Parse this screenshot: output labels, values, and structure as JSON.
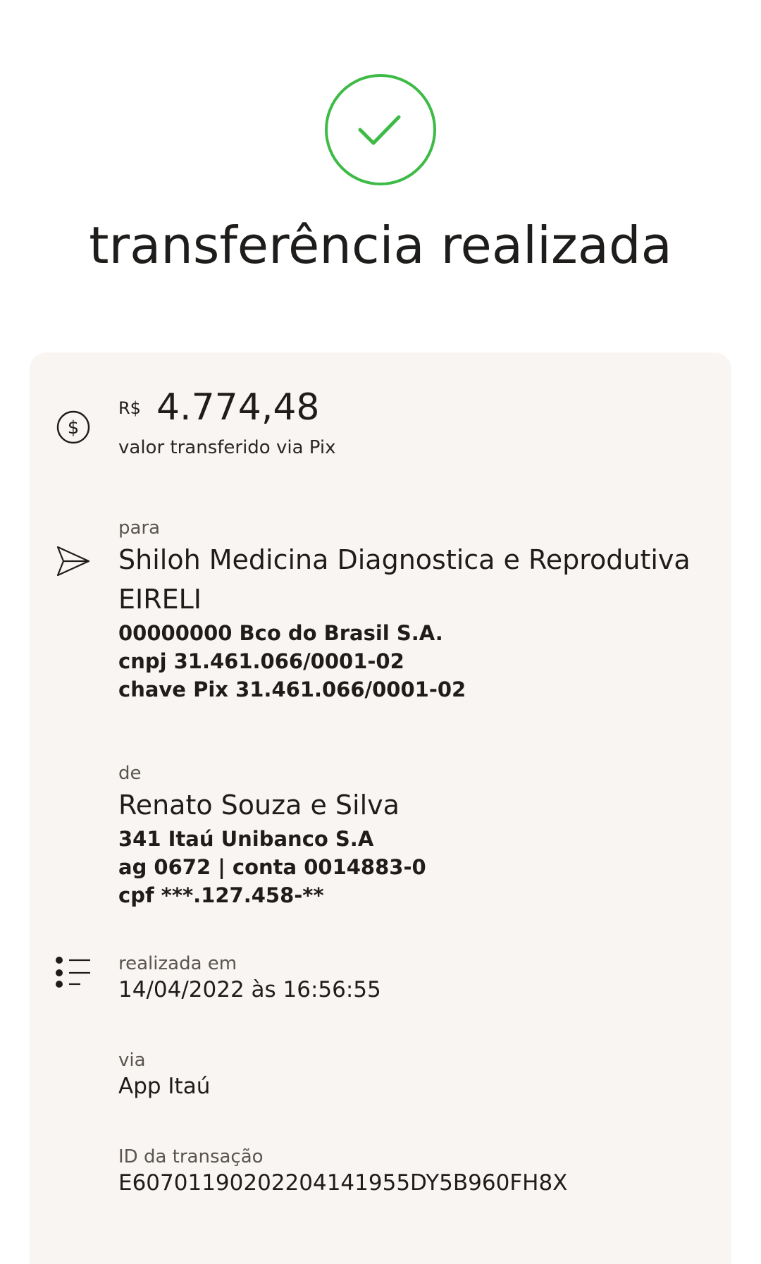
{
  "header": {
    "icon": "check-circle-icon",
    "icon_color": "#3dbb46",
    "title": "transferência realizada"
  },
  "amount": {
    "icon": "dollar-circle-icon",
    "currency": "R$",
    "value": "4.774,48",
    "caption": "valor transferido via Pix"
  },
  "recipient": {
    "icon": "send-icon",
    "label": "para",
    "name": "Shiloh Medicina Diagnostica e Reprodutiva EIRELI",
    "bank": "00000000 Bco do Brasil S.A.",
    "document": "cnpj 31.461.066/0001-02",
    "pix_key": "chave Pix 31.461.066/0001-02"
  },
  "sender": {
    "label": "de",
    "name": "Renato Souza e Silva",
    "bank": "341 Itaú Unibanco S.A",
    "account": "ag 0672 | conta 0014883-0",
    "document": "cpf ***.127.458-**"
  },
  "date": {
    "icon": "list-icon",
    "label": "realizada em",
    "value": "14/04/2022 às 16:56:55"
  },
  "channel": {
    "label": "via",
    "value": "App Itaú"
  },
  "transaction": {
    "label": "ID da transação",
    "value": "E60701190202204141955DY5B960FH8X"
  },
  "colors": {
    "success": "#3dbb46",
    "card_background": "#f8f5f2",
    "text": "#1f1d1b",
    "muted_text": "#5a5550"
  }
}
